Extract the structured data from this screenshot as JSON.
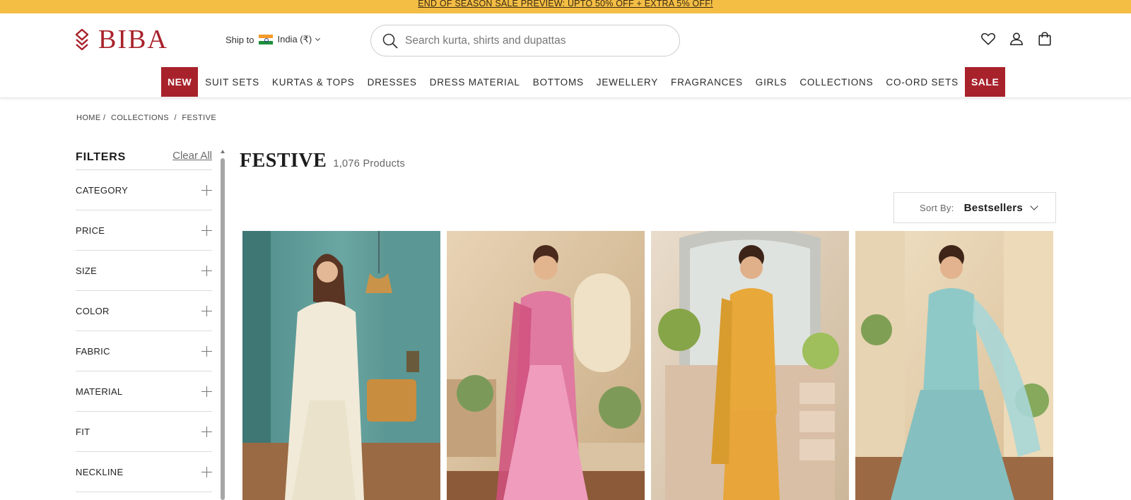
{
  "announcement": {
    "text": "END OF SEASON SALE PREVIEW: UPTO 50% OFF + EXTRA 5% OFF!"
  },
  "header": {
    "logo": "BIBA",
    "ship_label": "Ship to",
    "country": "India (₹)",
    "search_placeholder": "Search kurta, shirts and dupattas",
    "icons": [
      "heart-icon",
      "user-icon",
      "bag-icon"
    ]
  },
  "nav": {
    "new_badge": "NEW",
    "items": [
      "SUIT SETS",
      "KURTAS & TOPS",
      "DRESSES",
      "DRESS MATERIAL",
      "BOTTOMS",
      "JEWELLERY",
      "FRAGRANCES",
      "GIRLS",
      "COLLECTIONS",
      "CO-ORD SETS"
    ],
    "sale_badge": "SALE"
  },
  "breadcrumb": [
    "HOME /",
    "COLLECTIONS",
    "/",
    "FESTIVE"
  ],
  "filters": {
    "title": "FILTERS",
    "clear_all": "Clear All",
    "facets": [
      "CATEGORY",
      "PRICE",
      "SIZE",
      "COLOR",
      "FABRIC",
      "MATERIAL",
      "FIT",
      "NECKLINE"
    ]
  },
  "listing": {
    "title": "FESTIVE",
    "count": "1,076 Products",
    "sort_label": "Sort By:",
    "sort_value": "Bestsellers"
  },
  "colors": {
    "brand": "#a8222b",
    "announcement_bg": "#f4be45"
  }
}
